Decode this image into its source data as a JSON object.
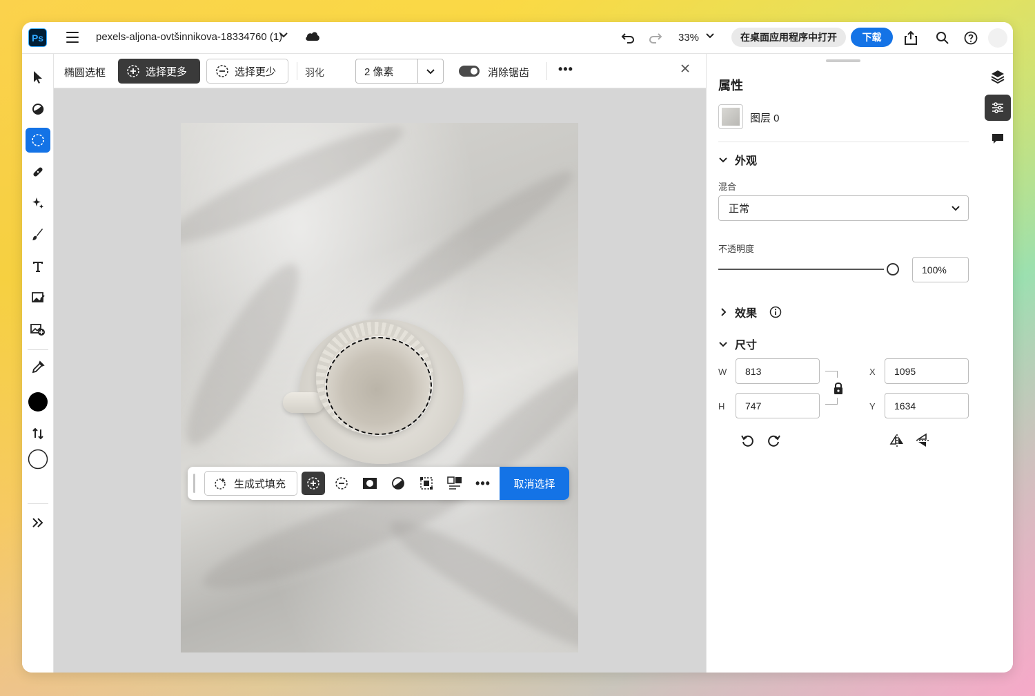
{
  "app": {
    "logo": "Ps",
    "document_title": "pexels-aljona-ovtšinnikova-18334760 (1)",
    "zoom": "33%",
    "open_desktop_label": "在桌面应用程序中打开",
    "download_label": "下载"
  },
  "options_bar": {
    "tool_name": "椭圆选框",
    "select_more_label": "选择更多",
    "select_less_label": "选择更少",
    "feather_label": "羽化",
    "feather_value": "2 像素",
    "antialias_label": "消除锯齿",
    "antialias_on": true
  },
  "context_bar": {
    "generative_fill_label": "生成式填充",
    "deselect_label": "取消选择"
  },
  "properties": {
    "title": "属性",
    "layer_name": "图层 0",
    "appearance_label": "外观",
    "blend_label": "混合",
    "blend_value": "正常",
    "opacity_label": "不透明度",
    "opacity_value": "100%",
    "opacity_fraction": 1.0,
    "effects_label": "效果",
    "dimensions_label": "尺寸",
    "w_label": "W",
    "h_label": "H",
    "x_label": "X",
    "y_label": "Y",
    "w_value": "813",
    "h_value": "747",
    "x_value": "1095",
    "y_value": "1634"
  },
  "colors": {
    "accent": "#1473e6",
    "foreground_swatch": "#000000",
    "background_swatch": "#ffffff"
  },
  "icons": {
    "left_tools": [
      "move-icon",
      "adjust-icon",
      "ellipse-marquee-icon",
      "healing-icon",
      "magic-icon",
      "brush-icon",
      "type-icon",
      "place-image-icon",
      "add-image-icon",
      "eyedropper-icon",
      "swap-colors-icon",
      "expand-icon"
    ],
    "rail": [
      "layers-icon",
      "properties-icon",
      "comments-icon"
    ]
  }
}
